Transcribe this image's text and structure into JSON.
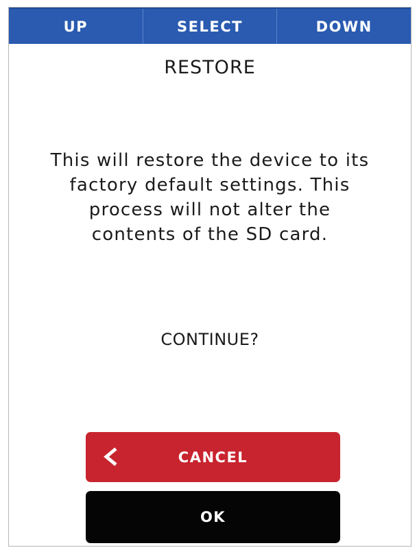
{
  "topbar": {
    "up_label": "UP",
    "select_label": "SELECT",
    "down_label": "DOWN",
    "background_color": "#2a5bb1"
  },
  "screen": {
    "title": "RESTORE",
    "message": "This will restore the device to its\nfactory default settings.  This\nprocess will not alter the\ncontents of the SD card.",
    "prompt": "CONTINUE?"
  },
  "buttons": {
    "cancel_label": "CANCEL",
    "cancel_icon": "chevron-left-icon",
    "cancel_color": "#c8242f",
    "ok_label": "OK",
    "ok_color": "#050505"
  }
}
